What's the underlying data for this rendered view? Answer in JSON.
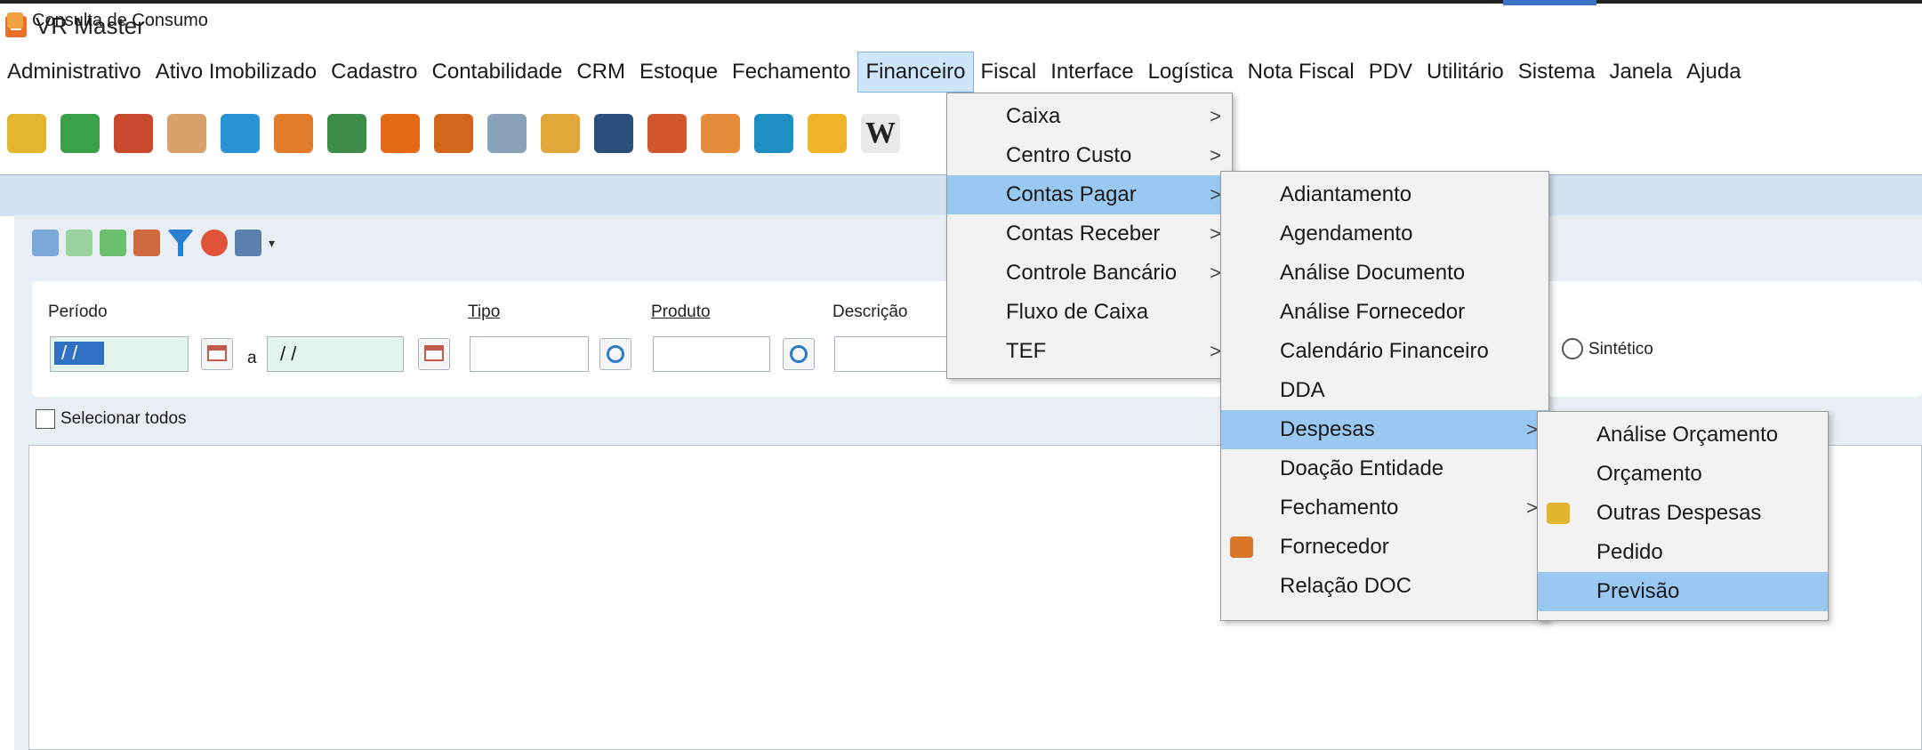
{
  "window": {
    "title": "VR Master"
  },
  "menubar": {
    "items": [
      "Administrativo",
      "Ativo Imobilizado",
      "Cadastro",
      "Contabilidade",
      "CRM",
      "Estoque",
      "Fechamento",
      "Financeiro",
      "Fiscal",
      "Interface",
      "Logística",
      "Nota Fiscal",
      "PDV",
      "Utilitário",
      "Sistema",
      "Janela",
      "Ajuda"
    ],
    "active": "Financeiro"
  },
  "toolbar": {
    "icons": [
      "money-icon",
      "tag-icon",
      "monitor-check-icon",
      "money-bag-icon",
      "transfer-icon",
      "cart-star-icon",
      "org-chart-icon",
      "offer-badge-icon",
      "delivery-truck-icon",
      "shopping-cart-icon",
      "folder-icon",
      "globe-icon",
      "invoice-icon",
      "calendar-icon",
      "chat-icon",
      "lock-icon",
      "w-icon"
    ],
    "w_label": "W"
  },
  "inner_window": {
    "title": "Consulta de Consumo"
  },
  "filters": {
    "periodo_label": "Período",
    "date_from": "/ /",
    "a_label": "a",
    "date_to": "/ /",
    "tipo_label": "Tipo",
    "produto_label": "Produto",
    "descricao_label": "Descrição",
    "sintetico_label": "Sintético",
    "selecionar_todos": "Selecionar todos"
  },
  "menus": {
    "financeiro": [
      {
        "label": "Caixa",
        "submenu": true
      },
      {
        "label": "Centro Custo",
        "submenu": true
      },
      {
        "label": "Contas Pagar",
        "submenu": true,
        "highlighted": true
      },
      {
        "label": "Contas Receber",
        "submenu": true
      },
      {
        "label": "Controle Bancário",
        "submenu": true
      },
      {
        "label": "Fluxo de Caixa",
        "submenu": false
      },
      {
        "label": "TEF",
        "submenu": true
      }
    ],
    "contas_pagar": [
      {
        "label": "Adiantamento",
        "submenu": false
      },
      {
        "label": "Agendamento",
        "submenu": false
      },
      {
        "label": "Análise Documento",
        "submenu": false
      },
      {
        "label": "Análise Fornecedor",
        "submenu": false
      },
      {
        "label": "Calendário Financeiro",
        "submenu": false
      },
      {
        "label": "DDA",
        "submenu": false
      },
      {
        "label": "Despesas",
        "submenu": true,
        "highlighted": true
      },
      {
        "label": "Doação Entidade",
        "submenu": false
      },
      {
        "label": "Fechamento",
        "submenu": true
      },
      {
        "label": "Fornecedor",
        "submenu": false,
        "icon": "truck-icon"
      },
      {
        "label": "Relação DOC",
        "submenu": false
      }
    ],
    "despesas": [
      {
        "label": "Análise Orçamento",
        "submenu": false
      },
      {
        "label": "Orçamento",
        "submenu": false
      },
      {
        "label": "Outras Despesas",
        "submenu": false,
        "icon": "folder-icon"
      },
      {
        "label": "Pedido",
        "submenu": false
      },
      {
        "label": "Previsão",
        "submenu": false,
        "highlighted": true
      }
    ],
    "arrow_glyph": ">"
  }
}
